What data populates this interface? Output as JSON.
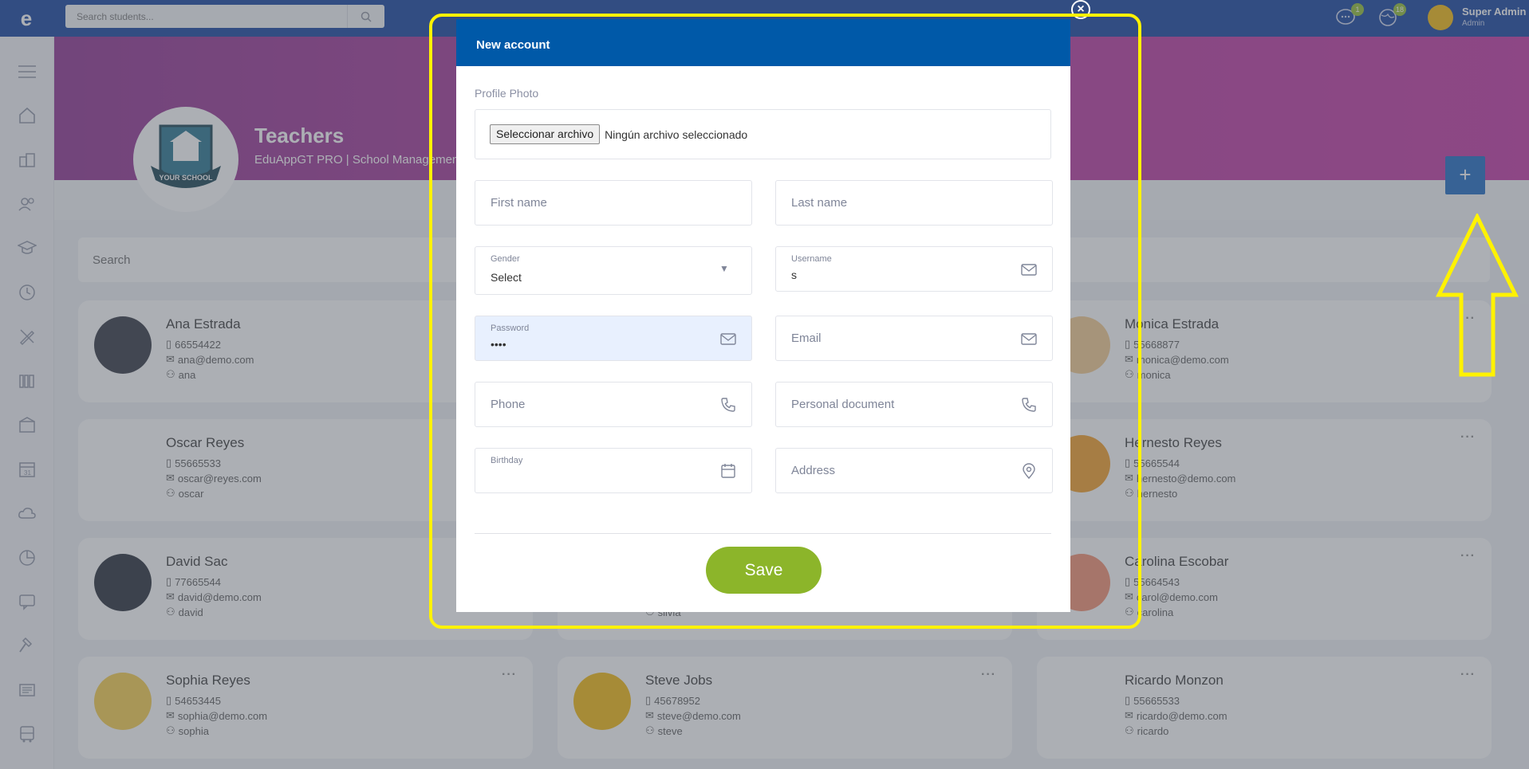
{
  "topbar": {
    "search_placeholder": "Search students...",
    "notifications": [
      {
        "icon": "chat-bubble-icon",
        "count": "1"
      },
      {
        "icon": "globe-icon",
        "count": "18"
      }
    ],
    "user_name": "Super Admin",
    "user_role": "Admin"
  },
  "sidebar": {
    "items": [
      "menu-icon",
      "home-icon",
      "courses-icon",
      "users-icon",
      "graduation-cap-icon",
      "clock-icon",
      "pencil-ruler-icon",
      "library-icon",
      "building-icon",
      "calendar-icon",
      "cloud-icon",
      "pie-chart-icon",
      "chat-icon",
      "gavel-icon",
      "newspaper-icon",
      "bus-icon"
    ]
  },
  "hero": {
    "title": "Teachers",
    "subtitle": "EduAppGT PRO | School Management",
    "school_logo_text": "YOUR SCHOOL",
    "add_label": "+"
  },
  "list": {
    "search_placeholder": "Search",
    "teachers": [
      {
        "name": "Ana Estrada",
        "phone": "66554422",
        "email": "ana@demo.com",
        "username": "ana",
        "color": "#2b2f3a"
      },
      {
        "name": "Monica Estrada",
        "phone": "55668877",
        "email": "monica@demo.com",
        "username": "monica",
        "color": "#f3c98b"
      },
      {
        "name": "Oscar Reyes",
        "phone": "55665533",
        "email": "oscar@reyes.com",
        "username": "oscar",
        "color": "#ffffff"
      },
      {
        "name": "Hernesto Reyes",
        "phone": "55665544",
        "email": "hernesto@demo.com",
        "username": "hernesto",
        "color": "#f29b1f"
      },
      {
        "name": "David Sac",
        "phone": "77665544",
        "email": "david@demo.com",
        "username": "david",
        "color": "#1e2530"
      },
      {
        "name": "Carolina Escobar",
        "phone": "55664543",
        "email": "carol@demo.com",
        "username": "carolina",
        "color": "#f28a6b"
      },
      {
        "name": "Sophia Reyes",
        "phone": "54653445",
        "email": "sophia@demo.com",
        "username": "sophia",
        "color": "#f7cc45"
      },
      {
        "name": "Steve Jobs",
        "phone": "45678952",
        "email": "steve@demo.com",
        "username": "steve",
        "color": "#f2b705"
      },
      {
        "name": "Ricardo Monzon",
        "phone": "55665533",
        "email": "ricardo@demo.com",
        "username": "ricardo",
        "color": "#ffffff"
      }
    ],
    "hidden_middle_username": "silvia"
  },
  "modal": {
    "title": "New account",
    "profile_photo_label": "Profile Photo",
    "file_button": "Seleccionar archivo",
    "file_status": "Ningún archivo seleccionado",
    "first_name_placeholder": "First name",
    "last_name_placeholder": "Last name",
    "gender_label": "Gender",
    "gender_value": "Select",
    "username_label": "Username",
    "username_value": "s",
    "password_label": "Password",
    "password_value": "••••",
    "email_placeholder": "Email",
    "phone_placeholder": "Phone",
    "personal_document_placeholder": "Personal document",
    "birthday_label": "Birthday",
    "address_placeholder": "Address",
    "save_label": "Save",
    "close_label": "×"
  },
  "colors": {
    "topbar": "#0b3a9a",
    "modal_header": "#0059a8",
    "save_button": "#8cb52a",
    "annotation": "#fff200"
  }
}
